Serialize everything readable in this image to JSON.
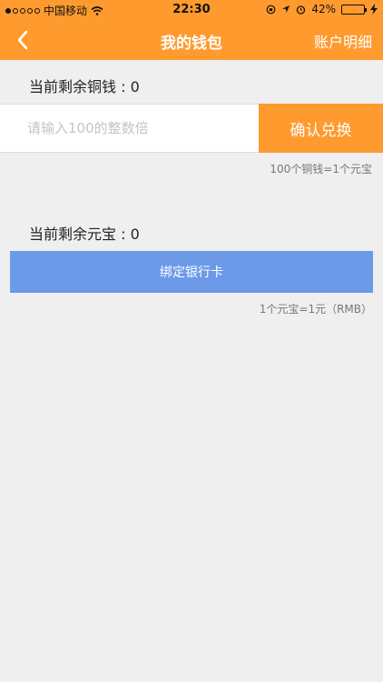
{
  "status_bar": {
    "carrier": "中国移动",
    "time": "22:30",
    "battery_percent": "42%",
    "battery_level": 0.42,
    "icons": [
      "signal-icon",
      "wifi-icon",
      "orientation-lock-icon",
      "location-icon",
      "alarm-icon",
      "battery-icon",
      "charging-icon"
    ]
  },
  "nav": {
    "title": "我的钱包",
    "right_label": "账户明细",
    "back_icon": "chevron-left-icon"
  },
  "copper": {
    "label": "当前剩余铜钱 : 0",
    "input_placeholder": "请输入100的整数倍",
    "input_value": "",
    "confirm_label": "确认兑换",
    "rate_note": "100个铜钱=1个元宝"
  },
  "yuanbao": {
    "label": "当前剩余元宝 : 0",
    "bind_card_label": "绑定银行卡",
    "rate_note": "1个元宝=1元（RMB）"
  },
  "colors": {
    "accent_orange": "#ff9a2e",
    "button_blue": "#6c9ae9",
    "background": "#efefef"
  }
}
